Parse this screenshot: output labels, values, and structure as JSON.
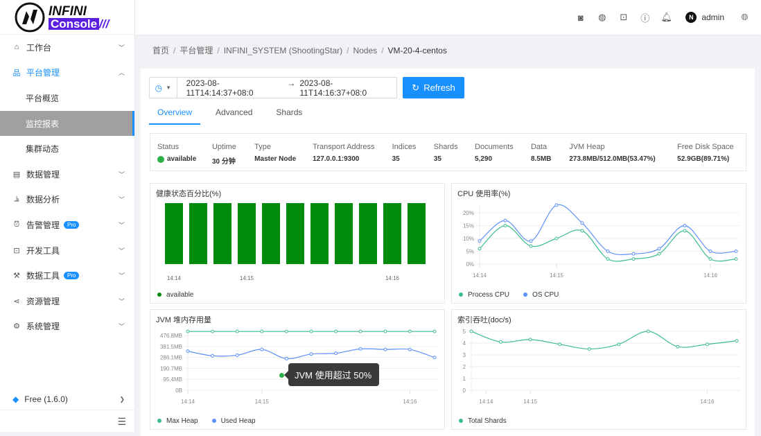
{
  "brand": {
    "line1": "INFINI",
    "line2": "Console",
    "line3": "///"
  },
  "header": {
    "icons": [
      "discord-icon",
      "github-icon",
      "terminal-icon",
      "help-icon",
      "bell-icon"
    ],
    "user": "admin",
    "avatar_letter": "N",
    "language_icon": "globe-icon"
  },
  "sidebar": {
    "items": [
      {
        "label": "工作台",
        "icon": "home-icon"
      },
      {
        "label": "平台管理",
        "icon": "cluster-icon",
        "expanded": true
      },
      {
        "label": "平台概览",
        "sub": true
      },
      {
        "label": "监控报表",
        "sub": true,
        "selected": true
      },
      {
        "label": "集群动态",
        "sub": true
      },
      {
        "label": "数据管理",
        "icon": "database-icon"
      },
      {
        "label": "数据分析",
        "icon": "chart-icon"
      },
      {
        "label": "告警管理",
        "icon": "alarm-icon",
        "badge": "Pro"
      },
      {
        "label": "开发工具",
        "icon": "code-icon"
      },
      {
        "label": "数据工具",
        "icon": "tool-icon",
        "badge": "Pro"
      },
      {
        "label": "资源管理",
        "icon": "share-icon"
      },
      {
        "label": "系统管理",
        "icon": "gear-icon"
      }
    ],
    "version": "Free (1.6.0)"
  },
  "breadcrumb": [
    "首页",
    "平台管理",
    "INFINI_SYSTEM (ShootingStar)",
    "Nodes",
    "VM-20-4-centos"
  ],
  "time_range": {
    "start": "2023-08-11T14:14:37+08:0",
    "end": "2023-08-11T14:16:37+08:0",
    "arrow": "→"
  },
  "refresh_label": "Refresh",
  "tabs": [
    {
      "label": "Overview",
      "active": true
    },
    {
      "label": "Advanced"
    },
    {
      "label": "Shards"
    }
  ],
  "stats": [
    {
      "k": "Status",
      "v": "available"
    },
    {
      "k": "Uptime",
      "v": "30 分钟"
    },
    {
      "k": "Type",
      "v": "Master Node"
    },
    {
      "k": "Transport Address",
      "v": "127.0.0.1:9300"
    },
    {
      "k": "Indices",
      "v": "35"
    },
    {
      "k": "Shards",
      "v": "35"
    },
    {
      "k": "Documents",
      "v": "5,290"
    },
    {
      "k": "Data",
      "v": "8.5MB"
    },
    {
      "k": "JVM Heap",
      "v": "273.8MB/512.0MB(53.47%)"
    },
    {
      "k": "Free Disk Space",
      "v": "52.9GB(89.71%)"
    }
  ],
  "colors": {
    "accent": "#1890ff",
    "green": "#008a0e",
    "teal": "#3dbd8f",
    "blue": "#5b8ff9"
  },
  "tooltip": "JVM 使用超过 50%",
  "chart_data": [
    {
      "type": "bar",
      "title": "健康状态百分比(%)",
      "ylim": [
        0,
        100
      ],
      "xticks": [
        {
          "label": "14:14",
          "at": 0.4
        },
        {
          "label": "14:15",
          "at": 3.4
        },
        {
          "label": "14:16",
          "at": 9.4
        }
      ],
      "series": [
        {
          "name": "available",
          "color": "#008a0e",
          "values": [
            100,
            100,
            100,
            100,
            100,
            100,
            100,
            100,
            100,
            100,
            100
          ]
        }
      ]
    },
    {
      "type": "line",
      "title": "CPU 使用率(%)",
      "ylim": [
        0,
        20
      ],
      "yticks": [
        "0%",
        "5%",
        "10%",
        "15%",
        "20%"
      ],
      "xticks": [
        {
          "label": "14:14",
          "at": 0
        },
        {
          "label": "14:15",
          "at": 3
        },
        {
          "label": "14:16",
          "at": 9
        }
      ],
      "series": [
        {
          "name": "Process CPU",
          "color": "#3dbd8f",
          "values": [
            6,
            15,
            7,
            10,
            13,
            2,
            2,
            4,
            13,
            2,
            2
          ]
        },
        {
          "name": "OS CPU",
          "color": "#5b8ff9",
          "values": [
            9,
            17,
            9,
            23,
            16,
            5,
            4,
            6,
            15,
            5,
            5
          ]
        }
      ]
    },
    {
      "type": "line",
      "title": "JVM 堆内存用量",
      "ylim": [
        0,
        476.8
      ],
      "yticks": [
        "0B",
        "95.4MB",
        "190.7MB",
        "286.1MB",
        "381.5MB",
        "476.8MB"
      ],
      "xticks": [
        {
          "label": "14:14",
          "at": 0
        },
        {
          "label": "14:15",
          "at": 3
        },
        {
          "label": "14:16",
          "at": 9
        }
      ],
      "series": [
        {
          "name": "Max Heap",
          "color": "#3dbd8f",
          "values": [
            512,
            512,
            512,
            512,
            512,
            512,
            512,
            512,
            512,
            512,
            512
          ]
        },
        {
          "name": "Used Heap",
          "color": "#5b8ff9",
          "values": [
            340,
            300,
            305,
            355,
            275,
            315,
            322,
            360,
            355,
            355,
            285
          ]
        }
      ]
    },
    {
      "type": "line",
      "title": "索引吞吐(doc/s)",
      "ylim": [
        0,
        5
      ],
      "yticks": [
        "0",
        "1",
        "2",
        "3",
        "4",
        "5"
      ],
      "xticks": [
        {
          "label": "14:14",
          "at": 0.5
        },
        {
          "label": "14:15",
          "at": 2
        },
        {
          "label": "14:16",
          "at": 8
        }
      ],
      "series": [
        {
          "name": "Total Shards",
          "color": "#3dbd8f",
          "values": [
            5,
            4.1,
            4.3,
            3.9,
            3.5,
            3.9,
            5,
            3.7,
            3.9,
            4.2
          ]
        }
      ]
    }
  ]
}
